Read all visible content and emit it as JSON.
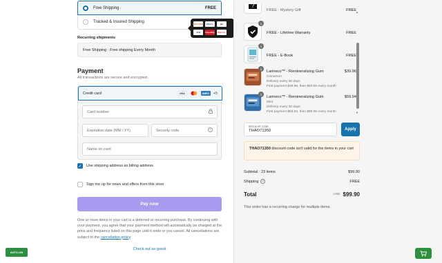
{
  "shipping": {
    "options": [
      {
        "label": "Free Shipping",
        "price": "FREE",
        "selected": true
      },
      {
        "label": "Tracked & Insured Shipping",
        "price": "",
        "selected": false
      }
    ]
  },
  "card_popover": {
    "brands": [
      "DISCOVER",
      "Diners",
      "elo",
      "JCB",
      "UnionPay",
      "Maestro"
    ]
  },
  "recurring": {
    "heading": "Recurring shipments",
    "value": "Free Shipping · Free shipping Every Month"
  },
  "payment": {
    "title": "Payment",
    "subtitle": "All transactions are secure and encrypted.",
    "method_label": "Credit card",
    "brand_logos": [
      "VISA",
      "Mastercard",
      "AMEX"
    ],
    "more_brands": "+5",
    "card_number_placeholder": "Card number",
    "expiry_placeholder": "Expiration date (MM / YY)",
    "security_placeholder": "Security code",
    "name_placeholder": "Name on card",
    "billing_checkbox_label": "Use shipping address as billing address",
    "billing_checked": true,
    "newsletter_label": "Sign me up for news and offers from this store",
    "newsletter_checked": false,
    "pay_button": "Pay now",
    "legal_text": "One or more items in your cart is a deferred or recurring purchase. By continuing with your payment, you agree that your payment method will automatically be charged at the price and frequency listed on this page until it ends or you cancel. All cancellations are subject to the",
    "legal_link": "cancellation policy",
    "legal_end": ".",
    "guest_link": "Check out as guest"
  },
  "badge": {
    "auto_on": "AUTO-ON"
  },
  "cart": {
    "items": [
      {
        "name": "FREE - Mystery Gift",
        "price": "FREE",
        "qty": "",
        "meta": []
      },
      {
        "name": "FREE - Lifetime Warranty",
        "price": "FREE",
        "qty": "1",
        "meta": []
      },
      {
        "name": "FREE - E-Book",
        "price": "FREE",
        "qty": "1",
        "meta": []
      },
      {
        "name": "Larineco™ - Remineralizing Gum",
        "price": "$39.96",
        "qty": "1",
        "meta": [
          "Cinnamon",
          "Delivery every 30 days",
          "First payment $39.96, then $60.00 every month"
        ]
      },
      {
        "name": "Larineco™ - Remineralizing Gum",
        "price": "$59.94",
        "qty": "1",
        "meta": [
          "Mint",
          "Delivery every 30 days",
          "First payment $59.94, then $90.00 every month"
        ]
      }
    ]
  },
  "discount": {
    "label": "Discount code",
    "value": "THAO71350",
    "apply": "Apply",
    "error_code": "THAO71350",
    "error_text": " discount code isn't valid for the items in your cart"
  },
  "summary": {
    "subtotal_label": "Subtotal · 23 items",
    "subtotal_value": "$99.90",
    "shipping_label": "Shipping",
    "shipping_value": "FREE",
    "total_label": "Total",
    "currency": "USD",
    "total_value": "$99.90",
    "note": "This order has a recurring charge for multiple items."
  }
}
